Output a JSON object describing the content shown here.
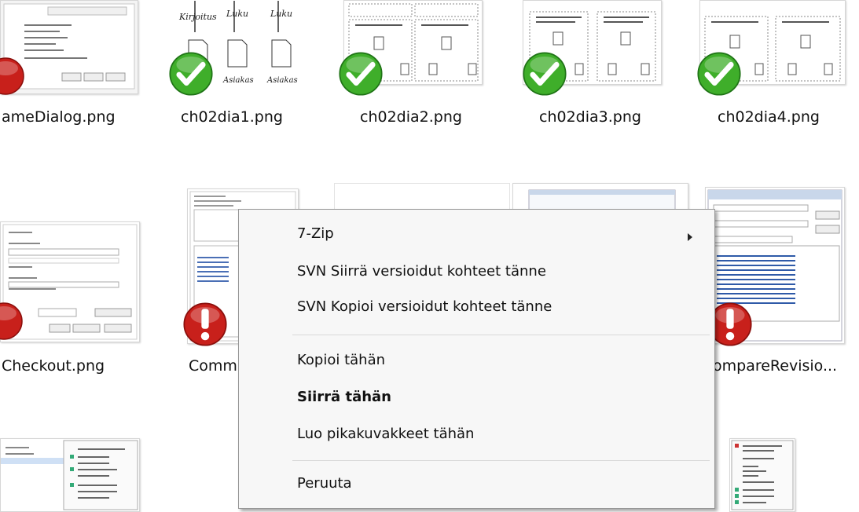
{
  "files": [
    {
      "name": "ameDialog.png",
      "status": "modified"
    },
    {
      "name": "ch02dia1.png",
      "status": "normal"
    },
    {
      "name": "ch02dia2.png",
      "status": "normal"
    },
    {
      "name": "ch02dia3.png",
      "status": "normal"
    },
    {
      "name": "ch02dia4.png",
      "status": "normal"
    },
    {
      "name": "Checkout.png",
      "status": "modified"
    },
    {
      "name": "Comm",
      "status": "modified"
    },
    {
      "name": "ompareRevisio...",
      "status": "modified"
    }
  ],
  "diagram_labels": {
    "kirjoitus": "Kirjoitus",
    "luku1": "Luku",
    "luku2": "Luku",
    "asiakas1": "Asiakas",
    "asiakas2": "Asiakas"
  },
  "context_menu": {
    "items": [
      {
        "label": "7-Zip",
        "has_submenu": true
      },
      {
        "label": "SVN Siirrä versioidut kohteet tänne"
      },
      {
        "label": "SVN Kopioi versioidut kohteet tänne"
      },
      {
        "label": "Kopioi tähän"
      },
      {
        "label": "Siirrä tähän",
        "default": true
      },
      {
        "label": "Luo pikakuvakkeet tähän"
      },
      {
        "label": "Peruuta"
      }
    ]
  },
  "colors": {
    "status_normal": "#3fae2a",
    "status_modified": "#c8201b"
  }
}
